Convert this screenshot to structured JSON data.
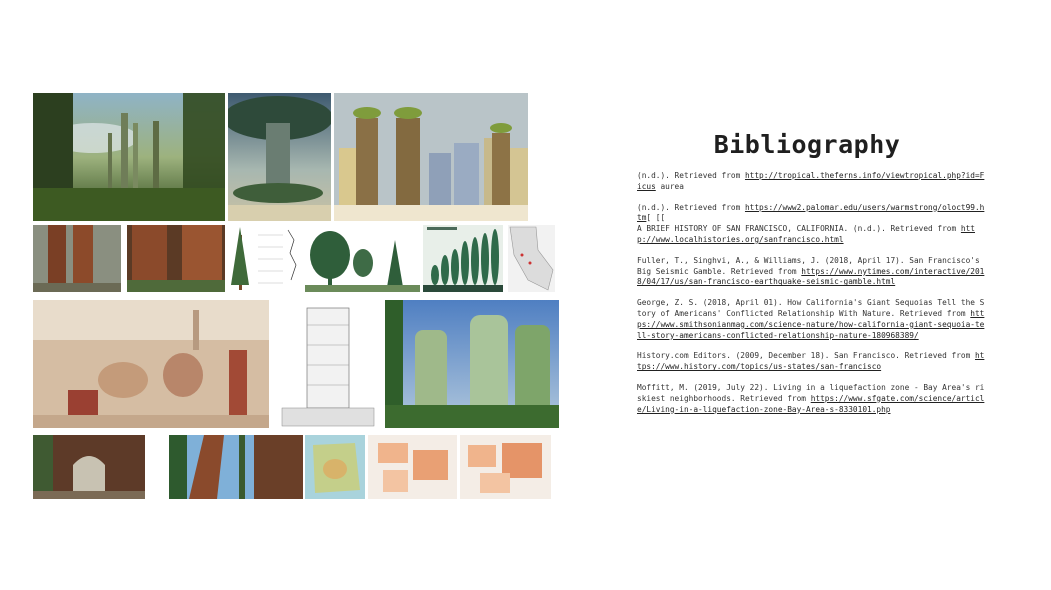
{
  "bibliography": {
    "title": "Bibliography",
    "entries": [
      {
        "prefix": "(n.d.). Retrieved from ",
        "link": "http://tropical.theferns.info/viewtropical.php?id=Ficus",
        "suffix": " aurea"
      },
      {
        "prefix": "(n.d.). Retrieved from ",
        "link": "https://www2.palomar.edu/users/warmstrong/oloct99.htm",
        "suffix": "[ [["
      },
      {
        "prefix": "A BRIEF HISTORY OF SAN FRANCISCO, CALIFORNIA. (n.d.). Retrieved from ",
        "link": "http://www.localhistories.org/sanfrancisco.html",
        "suffix": ""
      },
      {
        "prefix": "Fuller, T., Singhvi, A., & Williams, J. (2018, April 17). San Francisco's Big Seismic Gamble. Retrieved from ",
        "link": "https://www.nytimes.com/interactive/2018/04/17/us/san-francisco-earthquake-seismic-gamble.html",
        "suffix": ""
      },
      {
        "prefix": "George, Z. S. (2018, April 01). How California's Giant Sequoias Tell the Story of Americans' Conflicted Relationship With Nature. Retrieved from ",
        "link": "https://www.smithsonianmag.com/science-nature/how-california-giant-sequoia-tell-story-americans-conflicted-relationship-nature-180968389/",
        "suffix": ""
      },
      {
        "prefix": "History.com Editors. (2009, December 18). San Francisco. Retrieved from ",
        "link": "https://www.history.com/topics/us-states/san-francisco",
        "suffix": ""
      },
      {
        "prefix": "Moffitt, M. (2019, July 22). Living in a liquefaction zone - Bay Area's riskiest neighborhoods. Retrieved from ",
        "link": "https://www.sfgate.com/science/article/Living-in-a-liquefaction-zone-Bay-Area-s-8330101.php",
        "suffix": ""
      }
    ]
  }
}
